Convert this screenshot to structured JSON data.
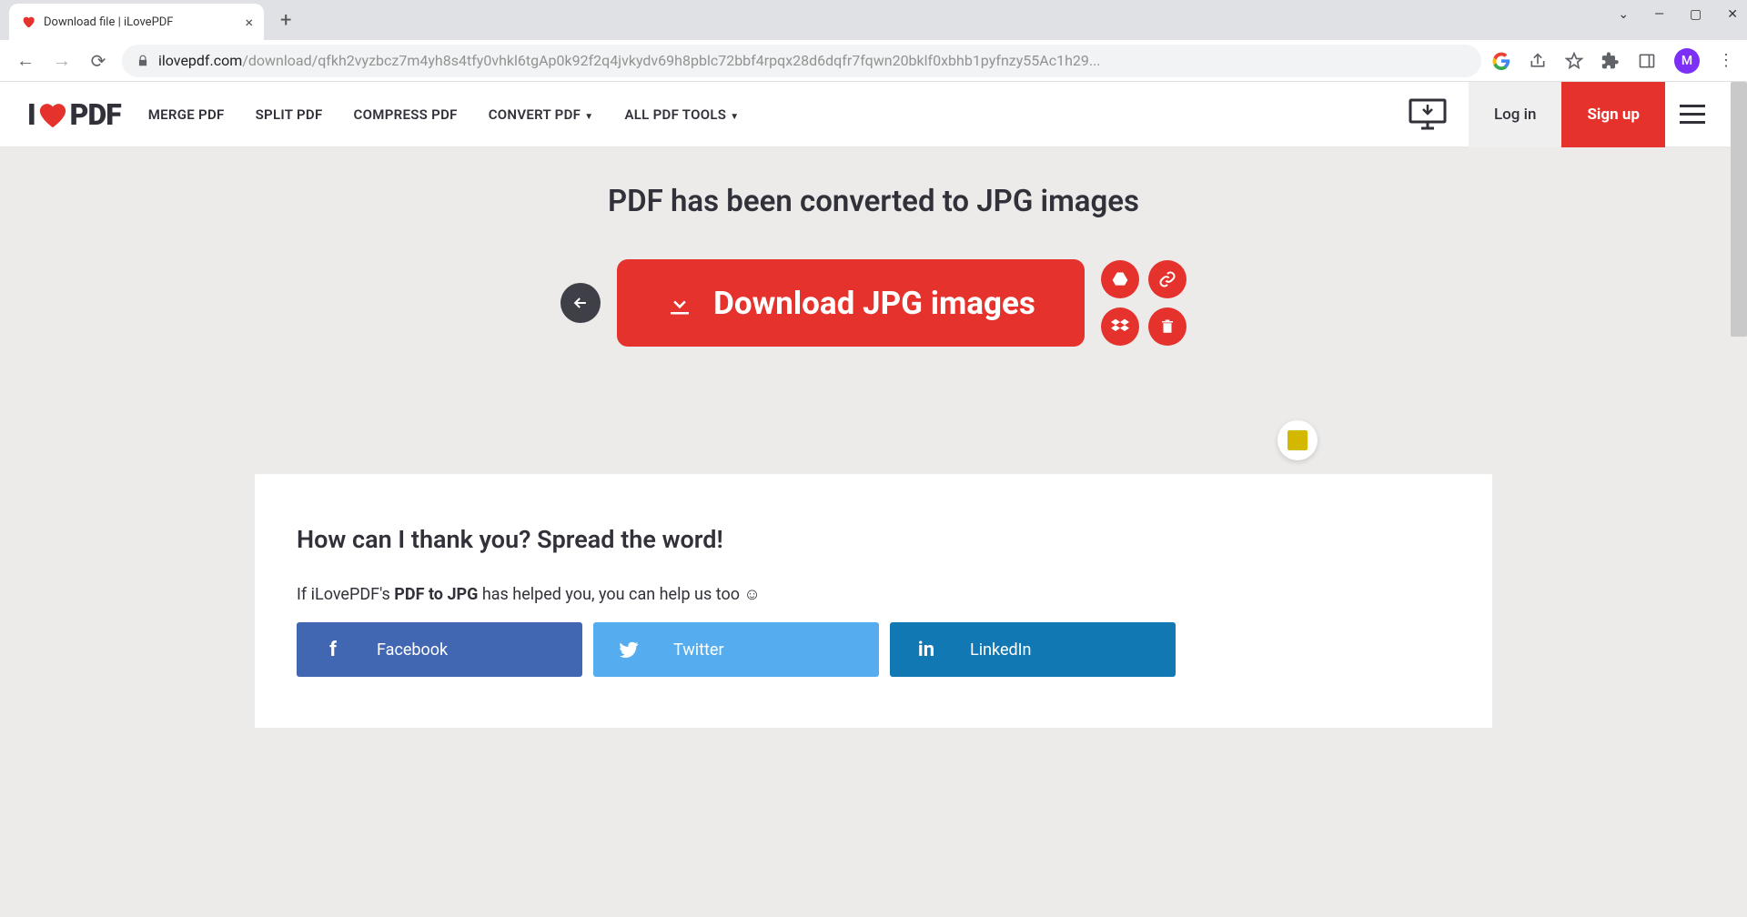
{
  "browser": {
    "tab_title": "Download file | iLovePDF",
    "url_host": "ilovepdf.com",
    "url_path": "/download/qfkh2vyzbcz7m4yh8s4tfy0vhkl6tgAp0k92f2q4jvkydv69h8pblc72bbf4rpqx28d6dqfr7fqwn20bklf0xbhb1pyfnzy55Ac1h29...",
    "avatar_initial": "M"
  },
  "header": {
    "logo_left": "I",
    "logo_right": "PDF",
    "nav": {
      "merge": "MERGE PDF",
      "split": "SPLIT PDF",
      "compress": "COMPRESS PDF",
      "convert": "CONVERT PDF",
      "all": "ALL PDF TOOLS"
    },
    "login": "Log in",
    "signup": "Sign up"
  },
  "main": {
    "headline": "PDF has been converted to JPG images",
    "download_label": "Download JPG images"
  },
  "share": {
    "title": "How can I thank you? Spread the word!",
    "sub_pre": "If iLovePDF's ",
    "sub_bold": "PDF to JPG",
    "sub_post": " has helped you, you can help us too ☺",
    "facebook": "Facebook",
    "twitter": "Twitter",
    "linkedin": "LinkedIn"
  }
}
